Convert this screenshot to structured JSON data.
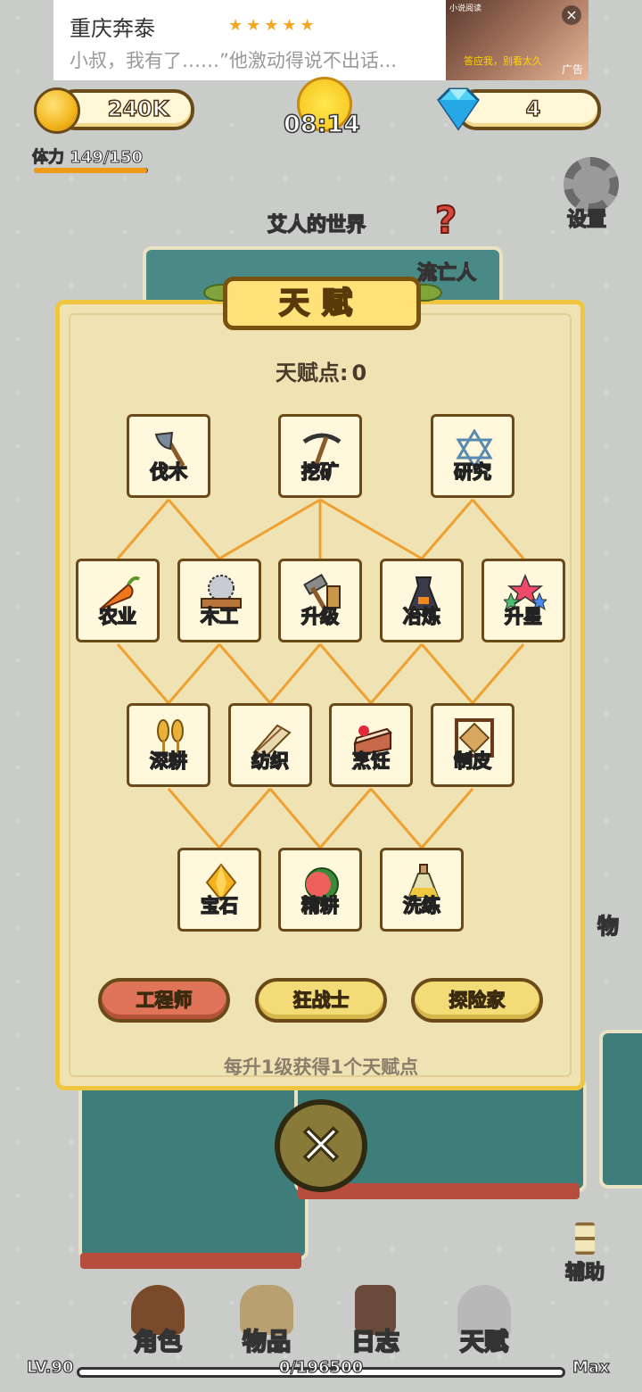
{
  "ad": {
    "title": "重庆奔泰",
    "stars": "★★★★★",
    "description": "小叔，我有了……”他激动得说不出话...",
    "image_tag": "小说阅读",
    "image_caption": "答应我，别看太久",
    "ad_label": "广告",
    "close_icon": "close-icon"
  },
  "hud": {
    "coins": "240K",
    "gems": "4",
    "time": "08:14",
    "stamina_label": "体力 149/150",
    "stamina_level": 0.993,
    "settings_label": "设置",
    "world_name": "艾人的世界",
    "npc_label": "流亡人",
    "quest_marker": "?",
    "side_label": "物"
  },
  "talent": {
    "title": "天赋",
    "points_label": "天赋点:",
    "points_value": "0",
    "nodes": [
      {
        "label": "伐木",
        "icon": "axe-icon"
      },
      {
        "label": "挖矿",
        "icon": "pickaxe-icon"
      },
      {
        "label": "研究",
        "icon": "star-of-david-icon"
      },
      {
        "label": "农业",
        "icon": "carrot-icon"
      },
      {
        "label": "木工",
        "icon": "saw-icon"
      },
      {
        "label": "升级",
        "icon": "hammer-icon"
      },
      {
        "label": "冶炼",
        "icon": "furnace-icon"
      },
      {
        "label": "升星",
        "icon": "stars-icon"
      },
      {
        "label": "深耕",
        "icon": "wheat-icon"
      },
      {
        "label": "纺织",
        "icon": "loom-icon"
      },
      {
        "label": "烹饪",
        "icon": "cake-icon"
      },
      {
        "label": "制皮",
        "icon": "hide-frame-icon"
      },
      {
        "label": "宝石",
        "icon": "gem-icon"
      },
      {
        "label": "精耕",
        "icon": "watermelon-icon"
      },
      {
        "label": "洗练",
        "icon": "potion-icon"
      }
    ],
    "classes": [
      "工程师",
      "狂战士",
      "探险家"
    ],
    "active_class": "工程师",
    "footnote": "每升1级获得1个天赋点"
  },
  "bottom": {
    "assist_label": "辅助",
    "nav": [
      "角色",
      "物品",
      "日志",
      "天赋"
    ],
    "level": "LV.90",
    "xp": "0/196500",
    "xp_fraction": 0,
    "max_label": "Max"
  },
  "colors": {
    "line": "#f0a030",
    "panel": "#efe3b4",
    "panel_border": "#f0c640",
    "active_class": "#e07458"
  }
}
